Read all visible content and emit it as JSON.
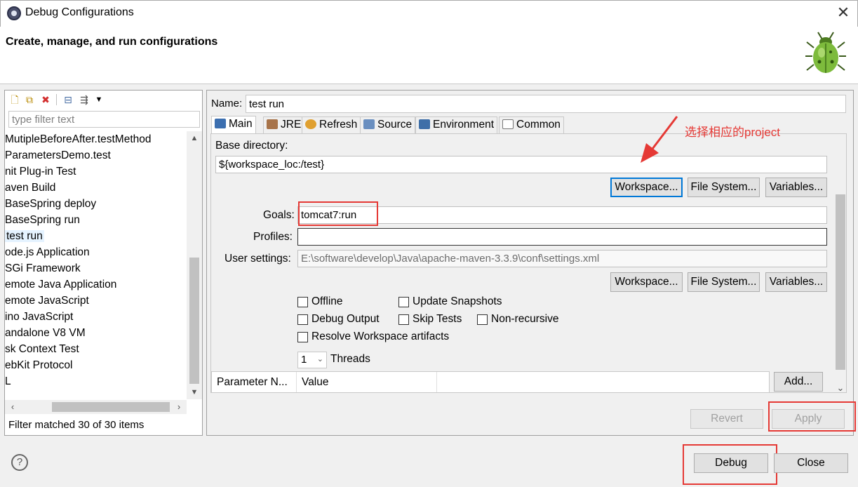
{
  "window": {
    "title": "Debug Configurations",
    "close_glyph": "✕"
  },
  "header": {
    "title": "Create, manage, and run configurations",
    "icon": "bug-icon"
  },
  "left": {
    "filter_placeholder": "type filter text",
    "toolbar_icons": [
      "new-config-icon",
      "duplicate-icon",
      "delete-icon",
      "collapse-all-icon",
      "filter-icon",
      "dropdown-chevron-icon"
    ],
    "items": [
      "MutipleBeforeAfter.testMethod",
      "ParametersDemo.test",
      "nit Plug-in Test",
      "aven Build",
      "BaseSpring deploy",
      "BaseSpring run",
      "test run",
      "ode.js Application",
      "SGi Framework",
      "emote Java Application",
      "emote JavaScript",
      "ino JavaScript",
      "andalone V8 VM",
      "sk Context Test",
      "ebKit Protocol",
      "L"
    ],
    "selected_index": 6,
    "status": "Filter matched 30 of 30 items"
  },
  "main": {
    "name_label": "Name:",
    "name_value": "test run",
    "tabs": [
      {
        "label": "Main",
        "icon": "maven-icon",
        "color": "#3c6fb0"
      },
      {
        "label": "JRE",
        "icon": "jre-icon",
        "color": "#a8744a"
      },
      {
        "label": "Refresh",
        "icon": "refresh-icon",
        "color": "#e0a030"
      },
      {
        "label": "Source",
        "icon": "source-icon",
        "color": "#6a8fc0"
      },
      {
        "label": "Environment",
        "icon": "environment-icon",
        "color": "#3f6fa8"
      },
      {
        "label": "Common",
        "icon": "common-icon",
        "color": "#777777"
      }
    ],
    "base_dir_label": "Base directory:",
    "base_dir_value": "${workspace_loc:/test}",
    "buttons": {
      "workspace": "Workspace...",
      "file_system": "File System...",
      "variables": "Variables..."
    },
    "goals_label": "Goals:",
    "goals_value": "tomcat7:run",
    "profiles_label": "Profiles:",
    "profiles_value": "",
    "user_settings_label": "User settings:",
    "user_settings_value": "E:\\software\\develop\\Java\\apache-maven-3.3.9\\conf\\settings.xml",
    "checkboxes": {
      "offline": "Offline",
      "update_snapshots": "Update Snapshots",
      "debug_output": "Debug Output",
      "skip_tests": "Skip Tests",
      "non_recursive": "Non-recursive",
      "resolve_workspace": "Resolve Workspace artifacts"
    },
    "threads_value": "1",
    "threads_label": "Threads",
    "table": {
      "col1": "Parameter N...",
      "col2": "Value"
    },
    "add_button": "Add...",
    "revert_button": "Revert",
    "apply_button": "Apply"
  },
  "annotation": {
    "text": "选择相应的project",
    "color": "#e53935"
  },
  "bottom": {
    "help": "?",
    "debug_button": "Debug",
    "close_button": "Close"
  }
}
